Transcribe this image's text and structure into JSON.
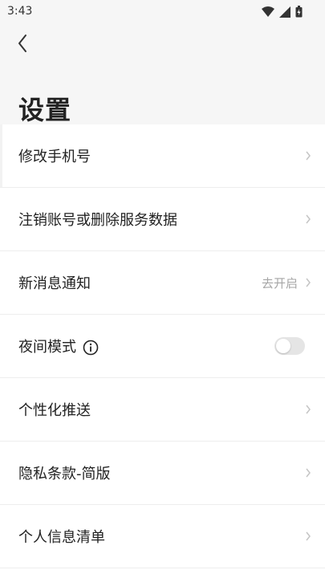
{
  "status_bar": {
    "time": "3:43",
    "icons": [
      "wifi-icon",
      "signal-icon",
      "battery-icon"
    ]
  },
  "header": {
    "back_icon": "chevron-left-icon",
    "title": "设置"
  },
  "settings": {
    "items": [
      {
        "label": "修改手机号",
        "type": "nav"
      },
      {
        "label": "注销账号或删除服务数据",
        "type": "nav"
      },
      {
        "label": "新消息通知",
        "type": "nav",
        "value": "去开启"
      },
      {
        "label": "夜间模式",
        "type": "toggle",
        "toggle_on": false,
        "info_icon": "info-icon"
      },
      {
        "label": "个性化推送",
        "type": "nav"
      },
      {
        "label": "隐私条款-简版",
        "type": "nav"
      },
      {
        "label": "个人信息清单",
        "type": "nav"
      }
    ]
  },
  "colors": {
    "background": "#f6f6f6",
    "surface": "#ffffff",
    "text_primary": "#222222",
    "text_secondary": "#a6a6a6",
    "divider": "#eeeeee",
    "toggle_off": "#e5e5e5"
  }
}
